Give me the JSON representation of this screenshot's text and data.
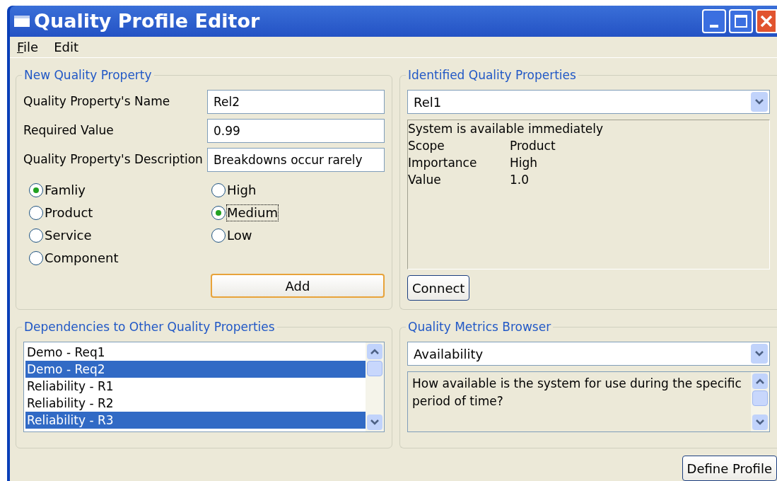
{
  "window": {
    "title": "Quality Profile Editor"
  },
  "menu": [
    {
      "label": "File",
      "mnemonic_underlined": true
    },
    {
      "label": "Edit",
      "mnemonic_underlined": false
    }
  ],
  "new_property": {
    "title": "New Quality Property",
    "fields": [
      {
        "label": "Quality Property's Name",
        "value": "Rel2"
      },
      {
        "label": "Required Value",
        "value": "0.99"
      },
      {
        "label": "Quality Property's Description",
        "value": "Breakdowns occur rarely"
      }
    ],
    "scopes": [
      {
        "label": "Famliy",
        "selected": true
      },
      {
        "label": "Product",
        "selected": false
      },
      {
        "label": "Service",
        "selected": false
      },
      {
        "label": "Component",
        "selected": false
      }
    ],
    "importance": [
      {
        "label": "High",
        "selected": false,
        "focused": false
      },
      {
        "label": "Medium",
        "selected": true,
        "focused": true
      },
      {
        "label": "Low",
        "selected": false,
        "focused": false
      }
    ],
    "add_button": "Add"
  },
  "identified": {
    "title": "Identified Quality Properties",
    "combo": "Rel1",
    "description": "System is available immediately",
    "details": [
      {
        "key": "Scope",
        "value": "Product"
      },
      {
        "key": "Importance",
        "value": "High"
      },
      {
        "key": "Value",
        "value": "1.0"
      }
    ],
    "connect_button": "Connect"
  },
  "dependencies": {
    "title": "Dependencies to Other Quality Properties",
    "items": [
      {
        "label": "Demo - Req1",
        "selected": false
      },
      {
        "label": "Demo - Req2",
        "selected": true
      },
      {
        "label": "Reliability - R1",
        "selected": false
      },
      {
        "label": "Reliability - R2",
        "selected": false
      },
      {
        "label": "Reliability - R3",
        "selected": true
      }
    ]
  },
  "metrics": {
    "title": "Quality Metrics Browser",
    "combo": "Availability",
    "text": "How available is the system for use during the specific period of time?"
  },
  "define_button": "Define Profile"
}
